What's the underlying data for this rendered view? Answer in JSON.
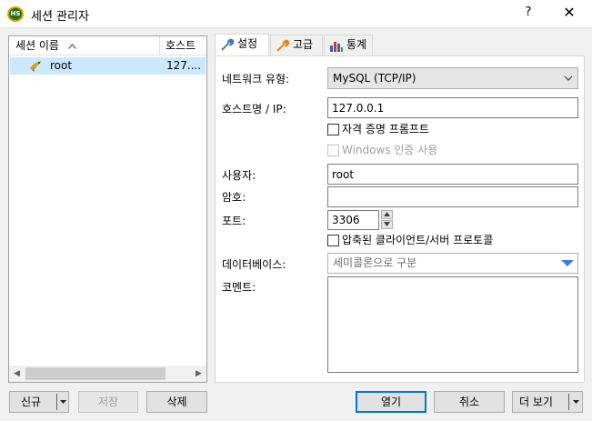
{
  "window": {
    "app_icon_text": "HS",
    "title": "세션 관리자",
    "help_label": "?",
    "close_label": "✕"
  },
  "session_list": {
    "columns": {
      "name": "세션 이름",
      "host": "호스트"
    },
    "sort_indicator": "^",
    "rows": [
      {
        "name": "root",
        "host": "127....",
        "icon": "session-dolphin-icon",
        "selected": true
      }
    ],
    "scroll_left": "◀",
    "scroll_right": "▶"
  },
  "tabs": [
    {
      "label": "설정",
      "icon": "wrench-icon",
      "active": true
    },
    {
      "label": "고급",
      "icon": "wrench-orange-icon",
      "active": false
    },
    {
      "label": "통계",
      "icon": "bar-chart-icon",
      "active": false
    }
  ],
  "settings": {
    "network_type_label": "네트워크 유형:",
    "network_type_value": "MySQL (TCP/IP)",
    "host_label": "호스트명 / IP:",
    "host_value": "127.0.0.1",
    "prompt_credentials_label": "자격 증명 프롬프트",
    "prompt_credentials_checked": false,
    "windows_auth_label": "Windows 인증 사용",
    "windows_auth_checked": false,
    "user_label": "사용자:",
    "user_value": "root",
    "password_label": "암호:",
    "password_value": "",
    "port_label": "포트:",
    "port_value": "3306",
    "compressed_label": "압축된 클라이언트/서버 프로토콜",
    "compressed_checked": false,
    "database_label": "데이터베이스:",
    "database_placeholder": "세미콜론으로 구분",
    "comment_label": "코멘트:",
    "comment_value": ""
  },
  "buttons": {
    "new": "신규",
    "save": "저장",
    "delete": "삭제",
    "open": "열기",
    "cancel": "취소",
    "more": "더 보기"
  },
  "colors": {
    "selection": "#cce8ff",
    "accent": "#0078d7",
    "dropdown_arrow": "#3c7dd6"
  }
}
